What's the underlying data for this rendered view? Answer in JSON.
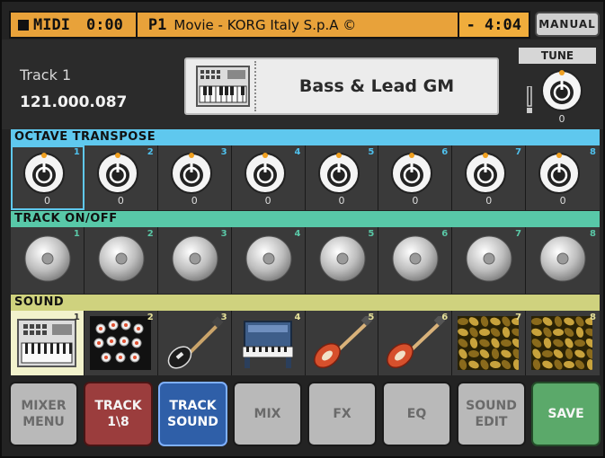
{
  "status_bar": {
    "mode": "MIDI",
    "elapsed": "0:00",
    "program": "P1",
    "song": "Movie - KORG Italy S.p.A ©",
    "remaining": "- 4:04",
    "manual_label": "MANUAL"
  },
  "track": {
    "name": "Track 1",
    "number": "121.000.087",
    "sound_name": "Bass & Lead GM",
    "tune_label": "TUNE",
    "tune_value": "0"
  },
  "sections": {
    "octave": "OCTAVE TRANSPOSE",
    "onoff": "TRACK ON/OFF",
    "sound": "SOUND"
  },
  "octave_knobs": [
    {
      "n": "1",
      "v": "0"
    },
    {
      "n": "2",
      "v": "0"
    },
    {
      "n": "3",
      "v": "0"
    },
    {
      "n": "4",
      "v": "0"
    },
    {
      "n": "5",
      "v": "0"
    },
    {
      "n": "6",
      "v": "0"
    },
    {
      "n": "7",
      "v": "0"
    },
    {
      "n": "8",
      "v": "0"
    }
  ],
  "track_toggles": [
    "1",
    "2",
    "3",
    "4",
    "5",
    "6",
    "7",
    "8"
  ],
  "sounds": [
    {
      "n": "1",
      "icon": "keyboard-icon"
    },
    {
      "n": "2",
      "icon": "drumkit-icon"
    },
    {
      "n": "3",
      "icon": "electric-guitar-icon"
    },
    {
      "n": "4",
      "icon": "organ-icon"
    },
    {
      "n": "5",
      "icon": "bass-guitar-icon"
    },
    {
      "n": "6",
      "icon": "bass-guitar-icon"
    },
    {
      "n": "7",
      "icon": "pad-texture-icon"
    },
    {
      "n": "8",
      "icon": "pad-texture-icon"
    }
  ],
  "buttons": [
    {
      "label": "MIXER\nMENU",
      "style": "gray"
    },
    {
      "label": "TRACK\n1\\8",
      "style": "red"
    },
    {
      "label": "TRACK\nSOUND",
      "style": "blue"
    },
    {
      "label": "MIX",
      "style": "gray"
    },
    {
      "label": "FX",
      "style": "gray"
    },
    {
      "label": "EQ",
      "style": "gray"
    },
    {
      "label": "SOUND\nEDIT",
      "style": "gray"
    },
    {
      "label": "SAVE",
      "style": "green"
    }
  ],
  "colors": {
    "status_bar": "#e8a23a",
    "octave_header": "#5fc8ee",
    "onoff_header": "#58c8a8",
    "sound_header": "#cfd27e",
    "save_button": "#5ba96a",
    "track_sound_button": "#2f5fa8",
    "track_18_button": "#9b3d3d"
  }
}
